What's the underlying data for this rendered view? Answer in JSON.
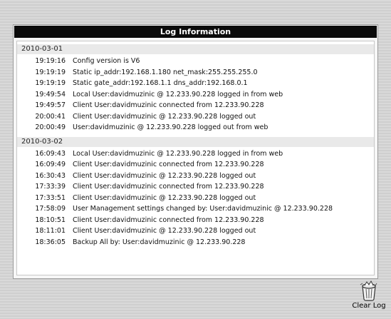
{
  "panel": {
    "title": "Log Information"
  },
  "groups": [
    {
      "date": "2010-03-01",
      "entries": [
        {
          "time": "19:19:16",
          "message": "Config version is V6"
        },
        {
          "time": "19:19:19",
          "message": "Static ip_addr:192.168.1.180 net_mask:255.255.255.0"
        },
        {
          "time": "19:19:19",
          "message": "Static gate_addr:192.168.1.1 dns_addr:192.168.0.1"
        },
        {
          "time": "19:49:54",
          "message": "Local User:davidmuzinic @ 12.233.90.228 logged in from web"
        },
        {
          "time": "19:49:57",
          "message": "Client User:davidmuzinic connected from 12.233.90.228"
        },
        {
          "time": "20:00:41",
          "message": "Client User:davidmuzinic @ 12.233.90.228 logged out"
        },
        {
          "time": "20:00:49",
          "message": "User:davidmuzinic @ 12.233.90.228 logged out from web"
        }
      ]
    },
    {
      "date": "2010-03-02",
      "entries": [
        {
          "time": "16:09:43",
          "message": "Local User:davidmuzinic @ 12.233.90.228 logged in from web"
        },
        {
          "time": "16:09:49",
          "message": "Client User:davidmuzinic connected from 12.233.90.228"
        },
        {
          "time": "16:30:43",
          "message": "Client User:davidmuzinic @ 12.233.90.228 logged out"
        },
        {
          "time": "17:33:39",
          "message": "Client User:davidmuzinic connected from 12.233.90.228"
        },
        {
          "time": "17:33:51",
          "message": "Client User:davidmuzinic @ 12.233.90.228 logged out"
        },
        {
          "time": "17:58:09",
          "message": "User Management settings changed by: User:davidmuzinic @ 12.233.90.228"
        },
        {
          "time": "18:10:51",
          "message": "Client User:davidmuzinic connected from 12.233.90.228"
        },
        {
          "time": "18:11:01",
          "message": "Client User:davidmuzinic @ 12.233.90.228 logged out"
        },
        {
          "time": "18:36:05",
          "message": "Backup All by: User:davidmuzinic @ 12.233.90.228"
        }
      ]
    }
  ],
  "actions": {
    "clear_log_label": "Clear Log",
    "clear_log_icon": "trash-bin-icon"
  }
}
